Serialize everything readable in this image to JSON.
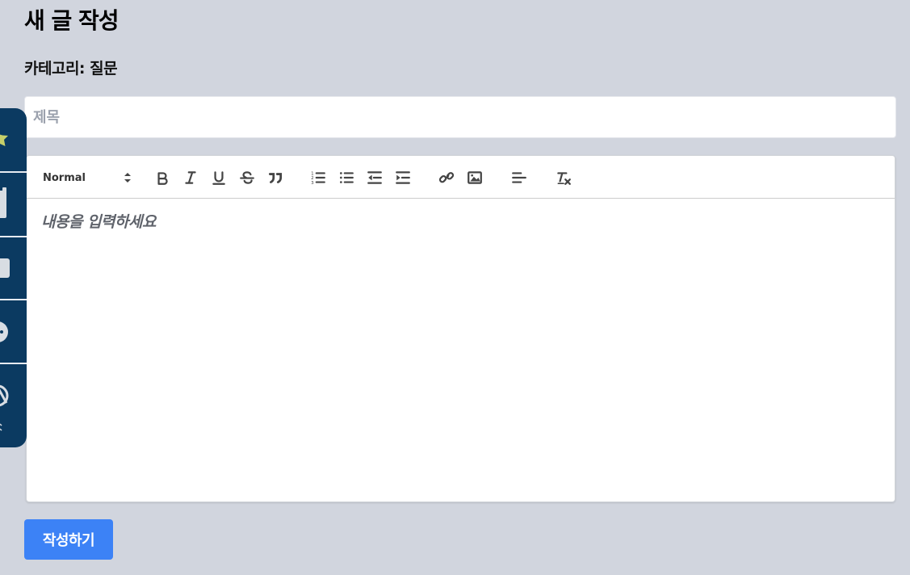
{
  "page": {
    "title": "새 글 작성",
    "category_line": "카테고리: 질문"
  },
  "form": {
    "title_placeholder": "제목",
    "content_placeholder": "내용을 입력하세요",
    "submit_label": "작성하기"
  },
  "toolbar": {
    "header_select_value": "Normal",
    "buttons": [
      "bold",
      "italic",
      "underline",
      "strike",
      "blockquote",
      "ordered-list",
      "bullet-list",
      "outdent",
      "indent",
      "link",
      "image",
      "align",
      "clean"
    ]
  },
  "sidebar": {
    "icons": [
      "star-icon",
      "clipboard-icon",
      "square-icon",
      "chat-icon",
      "globe-icon"
    ]
  },
  "colors": {
    "background": "#d1d5de",
    "sidebar": "#0b3a61",
    "accent": "#3c82f6",
    "star": "#c6cf6a"
  }
}
